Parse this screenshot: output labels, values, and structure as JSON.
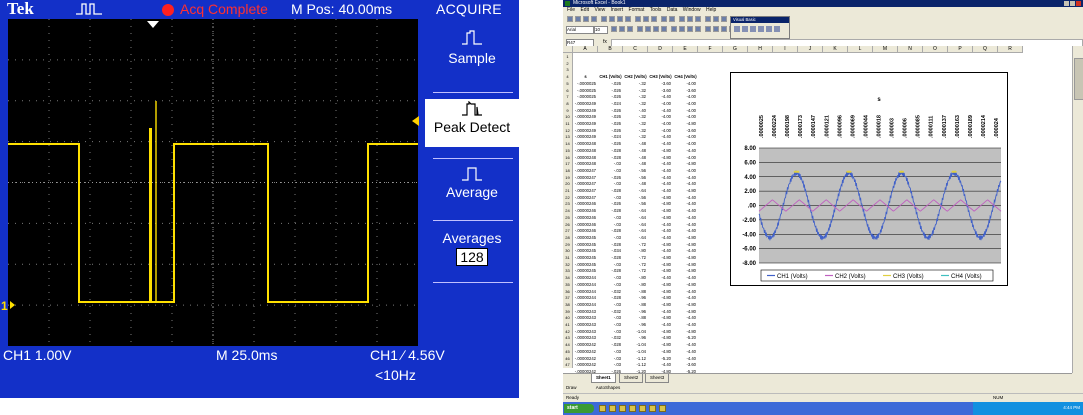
{
  "scope": {
    "brand": "Tek",
    "acq_status": "Acq Complete",
    "mpos": "M Pos: 40.00ms",
    "menu_title": "ACQUIRE",
    "menu_items": [
      {
        "label": "Sample",
        "selected": false
      },
      {
        "label": "Peak Detect",
        "selected": true
      },
      {
        "label": "Average",
        "selected": false
      }
    ],
    "averages_label": "Averages",
    "averages_value": "128",
    "ch1_marker": "1",
    "ch1_scale": "CH1  1.00V",
    "timebase": "M 25.0ms",
    "trigger": "CH1  ∕  4.56V",
    "trig_freq": "<10Hz",
    "colors": {
      "bezel": "#1330c8",
      "screen": "#000000",
      "trace": "#ffe000",
      "acq": "#ff3030"
    }
  },
  "excel": {
    "title": "Microsoft Excel - Book1",
    "menus": [
      "File",
      "Edit",
      "View",
      "Insert",
      "Format",
      "Tools",
      "Data",
      "Window",
      "Help"
    ],
    "font": "Arial",
    "font_size": "10",
    "zoom": "100%",
    "namebox": "R47",
    "fx": "fx",
    "columns": [
      "A",
      "B",
      "C",
      "D",
      "E",
      "F",
      "G",
      "H",
      "I",
      "J",
      "K",
      "L",
      "M",
      "N",
      "O",
      "P",
      "Q",
      "R"
    ],
    "headers": [
      "s",
      "CH1 (Volts)",
      "CH2 (Volts)",
      "CH3 (Volts)",
      "CH4 (Volts)"
    ],
    "rows": [
      [
        "-.0000025",
        "-.026",
        "-.32",
        "-3.60",
        "-4.00"
      ],
      [
        "-.0000025",
        "-.026",
        "-.32",
        "-3.60",
        "-3.60"
      ],
      [
        "-.0000025",
        "-.026",
        "-.32",
        "-4.40",
        "-4.00"
      ],
      [
        "-.00000249",
        "-.024",
        "-.32",
        "-4.00",
        "-4.00"
      ],
      [
        "-.00000249",
        "-.026",
        "-.40",
        "-4.40",
        "-4.00"
      ],
      [
        "-.00000249",
        "-.026",
        "-.32",
        "-4.00",
        "-4.00"
      ],
      [
        "-.00000249",
        "-.026",
        "-.32",
        "-4.00",
        "-4.80"
      ],
      [
        "-.00000249",
        "-.026",
        "-.32",
        "-4.00",
        "-3.60"
      ],
      [
        "-.00000249",
        "-.024",
        "-.32",
        "-4.40",
        "-4.00"
      ],
      [
        "-.00000248",
        "-.026",
        "-.48",
        "-4.40",
        "-4.00"
      ],
      [
        "-.00000248",
        "-.028",
        "-.48",
        "-4.80",
        "-4.40"
      ],
      [
        "-.00000248",
        "-.028",
        "-.48",
        "-4.80",
        "-4.00"
      ],
      [
        "-.00000248",
        "-.03",
        "-.48",
        "-4.40",
        "-4.80"
      ],
      [
        "-.00000247",
        "-.03",
        "-.56",
        "-4.40",
        "-4.00"
      ],
      [
        "-.00000247",
        "-.026",
        "-.56",
        "-4.40",
        "-4.40"
      ],
      [
        "-.00000247",
        "-.03",
        "-.48",
        "-4.40",
        "-4.40"
      ],
      [
        "-.00000247",
        "-.028",
        "-.64",
        "-4.40",
        "-4.80"
      ],
      [
        "-.00000247",
        "-.03",
        "-.56",
        "-4.80",
        "-4.40"
      ],
      [
        "-.00000246",
        "-.026",
        "-.56",
        "-4.80",
        "-4.40"
      ],
      [
        "-.00000246",
        "-.028",
        "-.64",
        "-4.80",
        "-4.40"
      ],
      [
        "-.00000246",
        "-.03",
        "-.64",
        "-4.80",
        "-4.40"
      ],
      [
        "-.00000246",
        "-.03",
        "-.64",
        "-4.40",
        "-4.40"
      ],
      [
        "-.00000246",
        "-.028",
        "-.64",
        "-4.40",
        "-4.40"
      ],
      [
        "-.00000245",
        "-.03",
        "-.64",
        "-4.40",
        "-4.80"
      ],
      [
        "-.00000245",
        "-.028",
        "-.72",
        "-4.80",
        "-4.80"
      ],
      [
        "-.00000245",
        "-.034",
        "-.80",
        "-4.40",
        "-4.40"
      ],
      [
        "-.00000245",
        "-.028",
        "-.72",
        "-4.80",
        "-4.80"
      ],
      [
        "-.00000245",
        "-.03",
        "-.72",
        "-4.80",
        "-4.80"
      ],
      [
        "-.00000245",
        "-.028",
        "-.72",
        "-4.80",
        "-4.80"
      ],
      [
        "-.00000244",
        "-.03",
        "-.80",
        "-4.40",
        "-4.40"
      ],
      [
        "-.00000244",
        "-.03",
        "-.80",
        "-4.80",
        "-4.80"
      ],
      [
        "-.00000244",
        "-.032",
        "-.88",
        "-4.80",
        "-4.40"
      ],
      [
        "-.00000244",
        "-.028",
        "-.96",
        "-4.80",
        "-4.40"
      ],
      [
        "-.00000244",
        "-.03",
        "-.88",
        "-4.80",
        "-4.80"
      ],
      [
        "-.00000243",
        "-.032",
        "-.96",
        "-4.40",
        "-4.80"
      ],
      [
        "-.00000243",
        "-.03",
        "-.88",
        "-4.80",
        "-4.40"
      ],
      [
        "-.00000243",
        "-.03",
        "-.96",
        "-4.40",
        "-4.40"
      ],
      [
        "-.00000243",
        "-.03",
        "-1.04",
        "-4.80",
        "-4.80"
      ],
      [
        "-.00000243",
        "-.032",
        "-.96",
        "-4.80",
        "-5.20"
      ],
      [
        "-.00000242",
        "-.028",
        "-1.04",
        "-4.80",
        "-4.40"
      ],
      [
        "-.00000242",
        "-.03",
        "-1.04",
        "-4.80",
        "-4.40"
      ],
      [
        "-.00000242",
        "-.03",
        "-1.12",
        "-5.20",
        "-4.40"
      ],
      [
        "-.00000242",
        "-.03",
        "-1.12",
        "-4.40",
        "-3.60"
      ],
      [
        "-.00000242",
        "-.026",
        "-1.20",
        "-4.80",
        "-5.20"
      ]
    ],
    "sheet_tabs": [
      "Sheet1",
      "Sheet2",
      "Sheet3"
    ],
    "draw_label": "Draw",
    "autoshapes": "AutoShapes",
    "status": "Ready",
    "num": "NUM",
    "start": "start",
    "clock": "4:44 PM",
    "vba_title": "Visual Basic",
    "colors": {
      "header": "#0a246a",
      "chart_plot": "#c0c0c0",
      "ch1": "#4060c8",
      "ch2": "#c060c0",
      "ch3": "#e0d040",
      "ch4": "#40c0c0"
    }
  },
  "chart_data": {
    "type": "line",
    "title": "s",
    "x_ticks": [
      ".0000025",
      ".0000224",
      ".0000198",
      ".0000173",
      ".0000147",
      ".0000121",
      ".0000096",
      ".0000069",
      ".0000044",
      ".0000018",
      ".000003",
      ".000006",
      ".0000085",
      ".0000111",
      ".0000137",
      ".0000163",
      ".0000189",
      ".0000214",
      ".000024"
    ],
    "ylim": [
      -8,
      8
    ],
    "y_ticks": [
      "8.00",
      "6.00",
      "4.00",
      "2.00",
      ".00",
      "-2.00",
      "-4.00",
      "-6.00",
      "-8.00"
    ],
    "legend_position": "bottom",
    "series": [
      {
        "name": "CH1 (Volts)",
        "shape": "sine",
        "amplitude": 4.5,
        "cycles": 4.6,
        "phase": 3.4,
        "offset": 0
      },
      {
        "name": "CH2 (Volts)",
        "shape": "triangle",
        "amplitude": 0.8,
        "cycles": 9,
        "phase": 0,
        "offset": 0
      },
      {
        "name": "CH3 (Volts)",
        "shape": "peaks",
        "amplitude": 4.7,
        "cycles": 4.6,
        "phase": 3.4,
        "offset": 0
      },
      {
        "name": "CH4 (Volts)",
        "shape": "flat",
        "amplitude": 0,
        "cycles": 0,
        "phase": 0,
        "offset": 0
      }
    ],
    "grid": true
  }
}
